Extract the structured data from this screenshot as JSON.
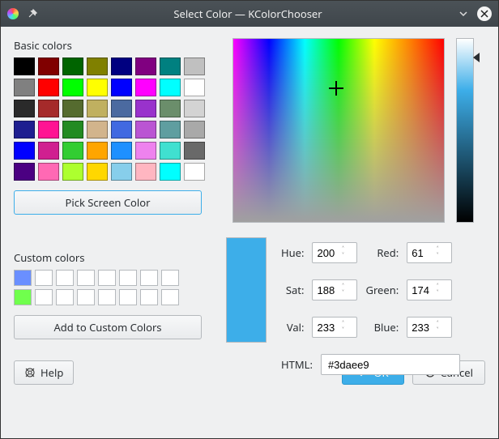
{
  "window": {
    "title": "Select Color — KColorChooser"
  },
  "labels": {
    "basic": "Basic colors",
    "custom": "Custom colors",
    "pick": "Pick Screen Color",
    "addCustom": "Add to Custom Colors",
    "hue": "Hue:",
    "sat": "Sat:",
    "val": "Val:",
    "red": "Red:",
    "green": "Green:",
    "blue": "Blue:",
    "html": "HTML:",
    "help": "Help",
    "ok": "OK",
    "cancel": "Cancel"
  },
  "values": {
    "hue": "200",
    "sat": "188",
    "val": "233",
    "red": "61",
    "green": "174",
    "blue": "233",
    "html": "#3daee9"
  },
  "basicColors": [
    "#000000",
    "#800000",
    "#006400",
    "#808000",
    "#000080",
    "#800080",
    "#008080",
    "#c0c0c0",
    "#808080",
    "#ff0000",
    "#00ff00",
    "#ffff00",
    "#0000ff",
    "#ff00ff",
    "#00ffff",
    "#ffffff",
    "#2a2a2a",
    "#a52a2a",
    "#556b2f",
    "#c0b060",
    "#4b6aa0",
    "#9932cc",
    "#6b8e6b",
    "#d3d3d3",
    "#1e1e90",
    "#ff1493",
    "#228b22",
    "#d2b48c",
    "#4169e1",
    "#ba55d3",
    "#5f9ea0",
    "#a9a9a9",
    "#0000ff",
    "#d02090",
    "#32cd32",
    "#ffa500",
    "#1e90ff",
    "#ee82ee",
    "#40e0d0",
    "#696969",
    "#4b0082",
    "#ff69b4",
    "#adff2f",
    "#ffd700",
    "#87ceeb",
    "#ffb6c1",
    "#00ffff",
    "#ffffff"
  ],
  "customColors": [
    [
      "#6a8fff",
      "#ffffff",
      "#ffffff",
      "#ffffff",
      "#ffffff",
      "#ffffff",
      "#ffffff",
      "#ffffff"
    ],
    [
      "#70ff4d",
      "#ffffff",
      "#ffffff",
      "#ffffff",
      "#ffffff",
      "#ffffff",
      "#ffffff",
      "#ffffff"
    ]
  ],
  "currentColor": "#3daee9"
}
